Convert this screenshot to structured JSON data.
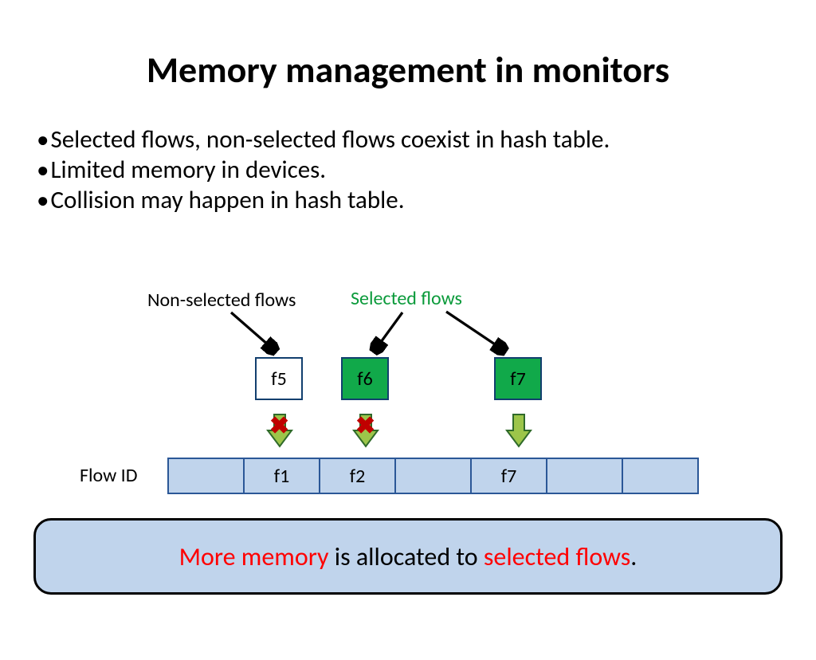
{
  "title": "Memory management in monitors",
  "bullets": [
    "Selected flows, non-selected flows coexist in hash table.",
    "Limited memory in devices.",
    "Collision may happen in hash table."
  ],
  "labels": {
    "non_selected": "Non-selected flows",
    "selected": "Selected flows",
    "flow_id": "Flow ID"
  },
  "flow_boxes": {
    "f5": "f5",
    "f6": "f6",
    "f7": "f7"
  },
  "hash_cells": [
    "",
    "f1",
    "f2",
    "",
    "f7",
    "",
    ""
  ],
  "conclusion": {
    "p1": "More memory",
    "p2": " is allocated to ",
    "p3": "selected flows",
    "p4": "."
  },
  "colors": {
    "selected_green": "#11a94a",
    "arrow_fill": "#9cc54a",
    "arrow_stroke": "#2f6a2a",
    "hash_bg": "#c0d4ec"
  }
}
